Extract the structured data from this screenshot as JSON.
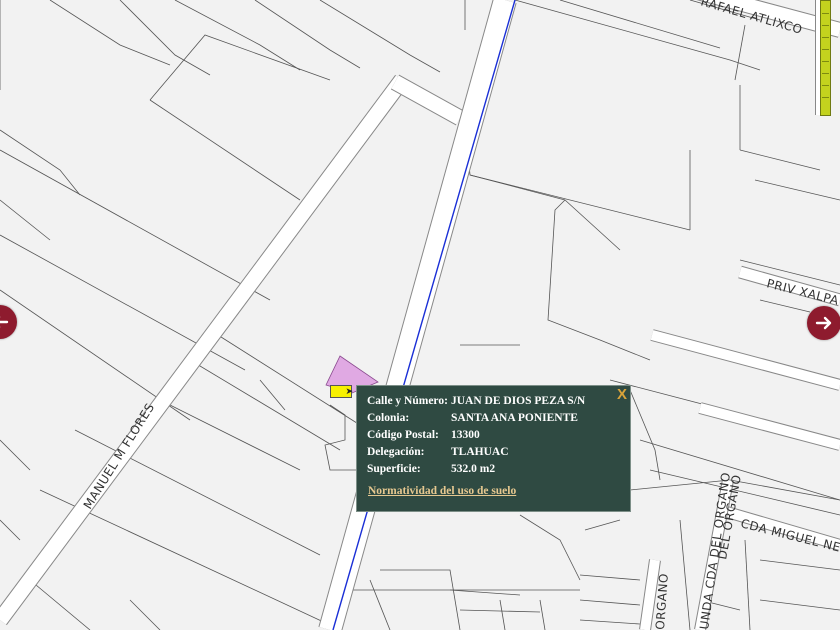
{
  "map": {
    "streets": {
      "rafael_atlixco": "RAFAEL ATLIXCO",
      "priv_xalpa": "PRIV XALPA",
      "manuel_m_flores": "MANUEL M FLORES",
      "cda_miguel_negrete": "CDA MIGUEL NEG",
      "segunda_cda_del_organo": "DEL ORGANO",
      "cda_del_organo_lower": "UNDA CDA DEL ORGANO",
      "organo": "ORGANO"
    },
    "colors": {
      "background": "#f2f2f2",
      "road": "#ffffff",
      "parcel_line": "#555555",
      "highlight_parcel": "#e0a9e3",
      "blue_route": "#1a2fd6",
      "nav_arrow": "#8e1b2e",
      "zoom_bar": "#c3d21e"
    },
    "icons": {
      "left_nav": "arrow-left-icon",
      "right_nav": "arrow-right-icon",
      "close": "close-icon"
    }
  },
  "popup": {
    "close_label": "X",
    "rows": [
      {
        "label": "Calle y Número:",
        "value": "JUAN DE DIOS PEZA S/N"
      },
      {
        "label": "Colonia:",
        "value": "SANTA ANA PONIENTE"
      },
      {
        "label": "Código Postal:",
        "value": "13300"
      },
      {
        "label": "Delegación:",
        "value": "TLAHUAC"
      },
      {
        "label": "Superficie:",
        "value": "532.0 m2"
      }
    ],
    "link_label": "Normatividad del uso de suelo"
  }
}
